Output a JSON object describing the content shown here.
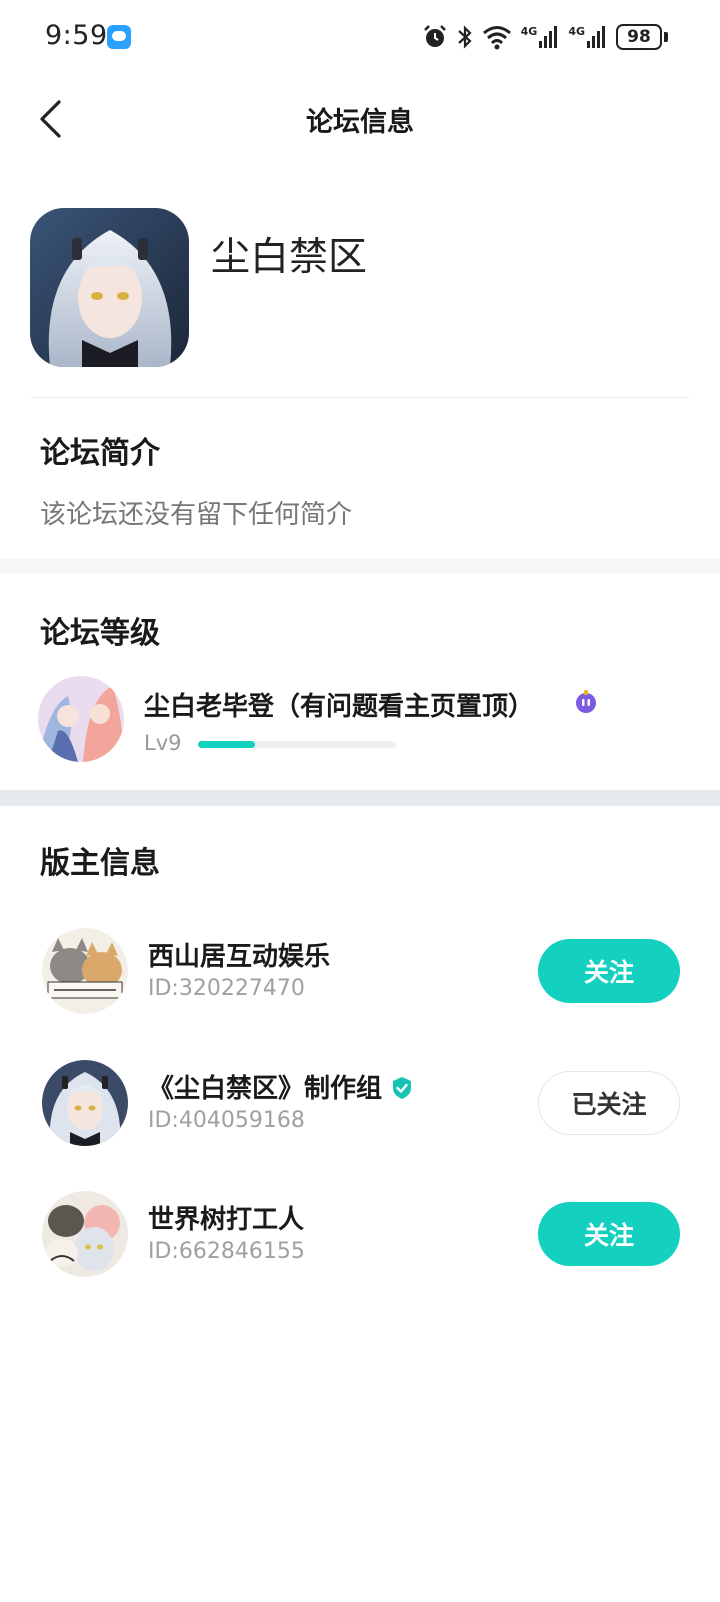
{
  "status_bar": {
    "time": "9:59",
    "battery": "98",
    "network_1": "4G",
    "network_2": "4G"
  },
  "nav": {
    "title": "论坛信息"
  },
  "forum": {
    "name": "尘白禁区"
  },
  "intro": {
    "title": "论坛简介",
    "text": "该论坛还没有留下任何简介"
  },
  "level": {
    "title": "论坛等级",
    "user_name": "尘白老毕登（有问题看主页置顶）",
    "level_label": "Lv9",
    "progress": 0.29
  },
  "moderators": {
    "title": "版主信息",
    "items": [
      {
        "name": "西山居互动娱乐",
        "id": "ID:320227470",
        "button": "关注",
        "followed": false,
        "verified": false
      },
      {
        "name": "《尘白禁区》制作组",
        "id": "ID:404059168",
        "button": "已关注",
        "followed": true,
        "verified": true
      },
      {
        "name": "世界树打工人",
        "id": "ID:662846155",
        "button": "关注",
        "followed": false,
        "verified": false
      }
    ]
  },
  "colors": {
    "accent": "#14d0bf",
    "section_gap": "#f4f6f8",
    "section_gap_2": "#e6e9ee"
  }
}
